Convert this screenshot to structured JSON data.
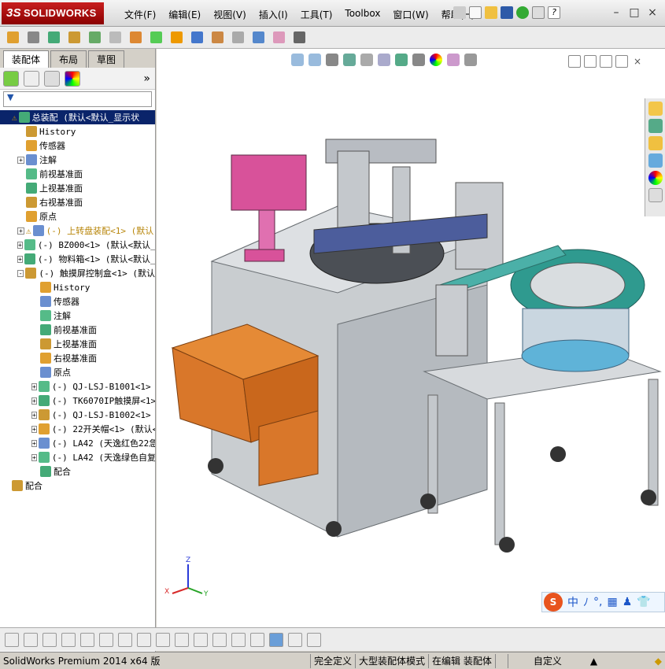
{
  "app": {
    "title": "SOLIDWORKS",
    "brand": "3S"
  },
  "menu": [
    "文件(F)",
    "编辑(E)",
    "视图(V)",
    "插入(I)",
    "工具(T)",
    "Toolbox",
    "窗口(W)",
    "帮助(H)"
  ],
  "tabs": [
    "装配体",
    "布局",
    "草图"
  ],
  "tree": [
    {
      "label": "总装配  (默认<默认_显示状",
      "level": 0,
      "selected": true,
      "warn": true,
      "expander": ""
    },
    {
      "label": "History",
      "level": 1,
      "expander": ""
    },
    {
      "label": "传感器",
      "level": 1,
      "expander": ""
    },
    {
      "label": "注解",
      "level": 1,
      "expander": "+"
    },
    {
      "label": "前视基准面",
      "level": 1,
      "expander": ""
    },
    {
      "label": "上视基准面",
      "level": 1,
      "expander": ""
    },
    {
      "label": "右视基准面",
      "level": 1,
      "expander": ""
    },
    {
      "label": "原点",
      "level": 1,
      "expander": ""
    },
    {
      "label": "(-) 上转盘装配<1> (默认",
      "level": 1,
      "warn": true,
      "expander": "+"
    },
    {
      "label": "(-) BZ000<1> (默认<默认_显",
      "level": 1,
      "expander": "+"
    },
    {
      "label": "(-) 物料箱<1> (默认<默认_显",
      "level": 1,
      "expander": "+"
    },
    {
      "label": "(-) 触摸屏控制盒<1> (默认",
      "level": 1,
      "expander": "-"
    },
    {
      "label": "History",
      "level": 2,
      "expander": ""
    },
    {
      "label": "传感器",
      "level": 2,
      "expander": ""
    },
    {
      "label": "注解",
      "level": 2,
      "expander": ""
    },
    {
      "label": "前视基准面",
      "level": 2,
      "expander": ""
    },
    {
      "label": "上视基准面",
      "level": 2,
      "expander": ""
    },
    {
      "label": "右视基准面",
      "level": 2,
      "expander": ""
    },
    {
      "label": "原点",
      "level": 2,
      "expander": ""
    },
    {
      "label": "(-) QJ-LSJ-B1001<1> (默",
      "level": 2,
      "expander": "+"
    },
    {
      "label": "(-) TK6070IP触摸屏<1>",
      "level": 2,
      "expander": "+"
    },
    {
      "label": "(-) QJ-LSJ-B1002<1> (默",
      "level": 2,
      "expander": "+"
    },
    {
      "label": "(-) 22开关帽<1> (默认<",
      "level": 2,
      "expander": "+"
    },
    {
      "label": "(-) LA42 (天逸红色22急",
      "level": 2,
      "expander": "+"
    },
    {
      "label": "(-) LA42 (天逸绿色自复",
      "level": 2,
      "expander": "+"
    },
    {
      "label": "配合",
      "level": 2,
      "expander": ""
    },
    {
      "label": "配合",
      "level": 0,
      "expander": ""
    }
  ],
  "status": {
    "product": "SolidWorks Premium 2014 x64 版",
    "s1": "完全定义",
    "s2": "大型装配体模式",
    "s3": "在编辑 装配体",
    "s4": "自定义"
  },
  "ime": {
    "chars": [
      "中",
      "ﾉ",
      "°,",
      "▦",
      "♟",
      "👕"
    ]
  },
  "axes": {
    "x": "X",
    "y": "Y",
    "z": "Z"
  }
}
